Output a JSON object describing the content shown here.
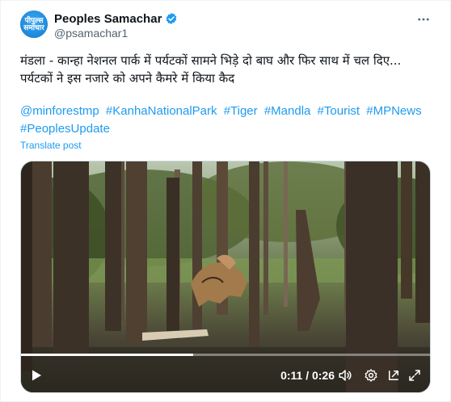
{
  "account": {
    "avatar_line1": "पीपुल्स",
    "avatar_line2": "समाचार",
    "display_name": "Peoples Samachar",
    "handle": "@psamachar1"
  },
  "tweet": {
    "line1": "मंडला - कान्हा नेशनल पार्क में पर्यटकों सामने भिड़े दो बाघ और फिर साथ में चल दिए...",
    "line2": "पर्यटकों ने इस नजारे को अपने कैमरे में किया कैद",
    "hashtags": [
      "@minforestmp",
      "#KanhaNationalPark",
      "#Tiger",
      "#Mandla",
      "#Tourist",
      "#MPNews",
      "#PeoplesUpdate"
    ],
    "translate_label": "Translate post"
  },
  "video": {
    "time_display": "0:11 / 0:26",
    "progress": 0.42
  },
  "icons": {
    "verified": "verified-badge-icon",
    "more": "more-options-icon",
    "play": "play-icon",
    "volume": "volume-icon",
    "settings": "settings-gear-icon",
    "popout": "popout-icon",
    "fullscreen": "fullscreen-icon"
  },
  "colors": {
    "accent": "#1d9bf0",
    "text": "#0f1419",
    "muted": "#536471"
  }
}
